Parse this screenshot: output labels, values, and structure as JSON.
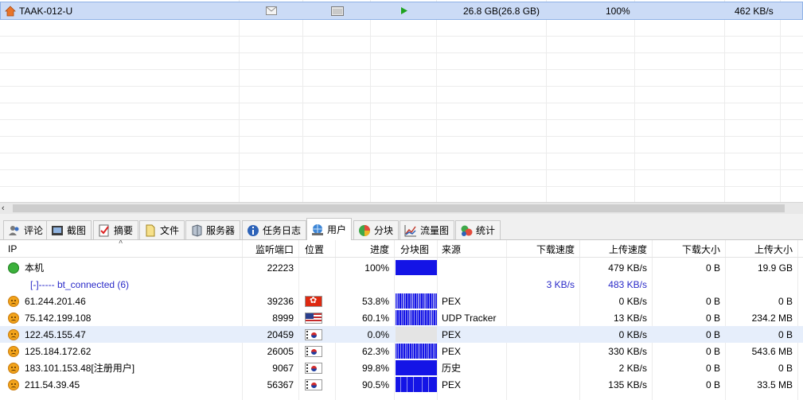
{
  "task": {
    "name": "TAAK-012-U",
    "size": "26.8 GB(26.8 GB)",
    "progress": "100%",
    "speed": "462 KB/s"
  },
  "tabs": [
    {
      "label": "评论",
      "icon": "comment-icon"
    },
    {
      "label": "截图",
      "icon": "screenshot-icon"
    },
    {
      "label": "摘要",
      "icon": "summary-icon"
    },
    {
      "label": "文件",
      "icon": "file-icon"
    },
    {
      "label": "服务器",
      "icon": "server-icon"
    },
    {
      "label": "任务日志",
      "icon": "info-icon"
    },
    {
      "label": "用户",
      "icon": "users-icon",
      "active": true
    },
    {
      "label": "分块",
      "icon": "pie-icon"
    },
    {
      "label": "流量图",
      "icon": "chart-icon"
    },
    {
      "label": "统计",
      "icon": "stats-icon"
    }
  ],
  "peers_header": {
    "ip": "IP",
    "port": "监听端口",
    "location": "位置",
    "progress": "进度",
    "chunks": "分块图",
    "source": "来源",
    "down_speed": "下载速度",
    "up_speed": "上传速度",
    "down_size": "下载大小",
    "up_size": "上传大小"
  },
  "peers": [
    {
      "ip": "本机",
      "status": "green",
      "port": "22223",
      "flag": "",
      "progress": "100%",
      "chunk_fill": 1.0,
      "source": "",
      "down_speed": "",
      "up_speed": "479 KB/s",
      "down_size": "0 B",
      "up_size": "19.9 GB"
    },
    {
      "ip": "[-]----- bt_connected (6)",
      "group": true,
      "down_speed": "3 KB/s",
      "up_speed": "483 KB/s"
    },
    {
      "ip": "61.244.201.46",
      "status": "orange",
      "port": "39236",
      "flag": "hk",
      "progress": "53.8%",
      "chunk_fill": 0.538,
      "source": "PEX",
      "down_speed": "",
      "up_speed": "0 KB/s",
      "down_size": "0 B",
      "up_size": "0 B"
    },
    {
      "ip": "75.142.199.108",
      "status": "orange",
      "port": "8999",
      "flag": "us",
      "progress": "60.1%",
      "chunk_fill": 0.601,
      "source": "UDP Tracker",
      "down_speed": "",
      "up_speed": "13 KB/s",
      "down_size": "0 B",
      "up_size": "234.2 MB"
    },
    {
      "ip": "122.45.155.47",
      "status": "orange",
      "port": "20459",
      "flag": "kr",
      "progress": "0.0%",
      "chunk_fill": 0.0,
      "source": "PEX",
      "down_speed": "",
      "up_speed": "0 KB/s",
      "down_size": "0 B",
      "up_size": "0 B",
      "highlight": true
    },
    {
      "ip": "125.184.172.62",
      "status": "orange",
      "port": "26005",
      "flag": "kr",
      "progress": "62.3%",
      "chunk_fill": 0.623,
      "source": "PEX",
      "down_speed": "",
      "up_speed": "330 KB/s",
      "down_size": "0 B",
      "up_size": "543.6 MB"
    },
    {
      "ip": "183.101.153.48[注册用户]",
      "status": "orange",
      "port": "9067",
      "flag": "kr",
      "progress": "99.8%",
      "chunk_fill": 0.998,
      "source": "历史",
      "down_speed": "",
      "up_speed": "2 KB/s",
      "down_size": "0 B",
      "up_size": "0 B"
    },
    {
      "ip": "211.54.39.45",
      "status": "orange",
      "port": "56367",
      "flag": "kr",
      "progress": "90.5%",
      "chunk_fill": 0.905,
      "source": "PEX",
      "down_speed": "",
      "up_speed": "135 KB/s",
      "down_size": "0 B",
      "up_size": "33.5 MB"
    }
  ],
  "colors": {
    "selection": "#cbdbf6",
    "chunk_fill": "#1414e6",
    "group_text": "#2a2ac8"
  }
}
